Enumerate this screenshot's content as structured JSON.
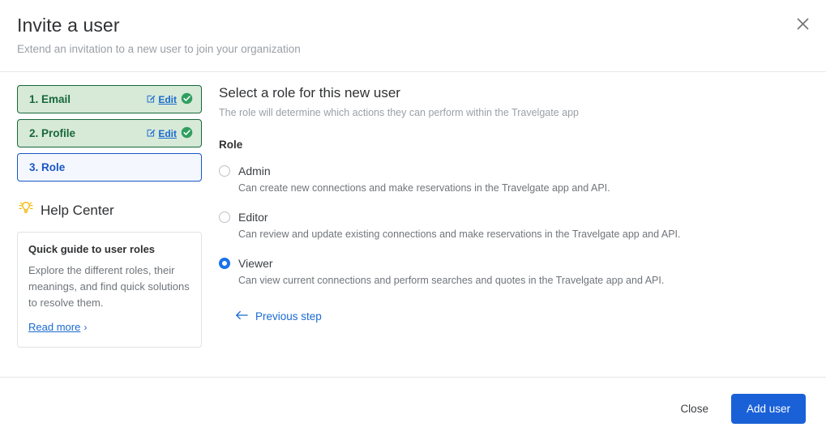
{
  "header": {
    "title": "Invite a user",
    "subtitle": "Extend an invitation to a new user to join your organization",
    "close_icon": "close-icon"
  },
  "steps": [
    {
      "label": "1. Email",
      "state": "done",
      "edit_label": "Edit",
      "edit_icon": "edit-pencil-icon",
      "status_icon": "check-circle-icon"
    },
    {
      "label": "2. Profile",
      "state": "done",
      "edit_label": "Edit",
      "edit_icon": "edit-pencil-icon",
      "status_icon": "check-circle-icon"
    },
    {
      "label": "3. Role",
      "state": "active",
      "edit_label": "",
      "edit_icon": "",
      "status_icon": ""
    }
  ],
  "help_center": {
    "icon": "lightbulb-icon",
    "title": "Help Center",
    "card": {
      "title": "Quick guide to user roles",
      "text": "Explore the different roles, their meanings, and find quick solutions to resolve them.",
      "link_label": "Read more",
      "link_chevron": "›"
    }
  },
  "main": {
    "title": "Select a role for this new user",
    "subtitle": "The role will determine which actions they can perform within the Travelgate app",
    "field_label": "Role",
    "roles": [
      {
        "value": "admin",
        "label": "Admin",
        "description": "Can create new connections and make reservations in the Travelgate app and API.",
        "selected": false
      },
      {
        "value": "editor",
        "label": "Editor",
        "description": "Can review and update existing connections and make reservations in the Travelgate app and API.",
        "selected": false
      },
      {
        "value": "viewer",
        "label": "Viewer",
        "description": "Can view current connections and perform searches and quotes in the Travelgate app and API.",
        "selected": true
      }
    ],
    "previous_step": {
      "label": "Previous step",
      "icon": "arrow-left-icon"
    }
  },
  "footer": {
    "close_label": "Close",
    "submit_label": "Add user"
  },
  "colors": {
    "primary": "#1a61d8",
    "link": "#1a6ad1",
    "success": "#17683a",
    "success_bg": "#d7e9d7",
    "active_border": "#1a56c4",
    "active_bg": "#f4f8fe",
    "muted_text": "#70757a",
    "lightbulb": "#f2b705"
  }
}
